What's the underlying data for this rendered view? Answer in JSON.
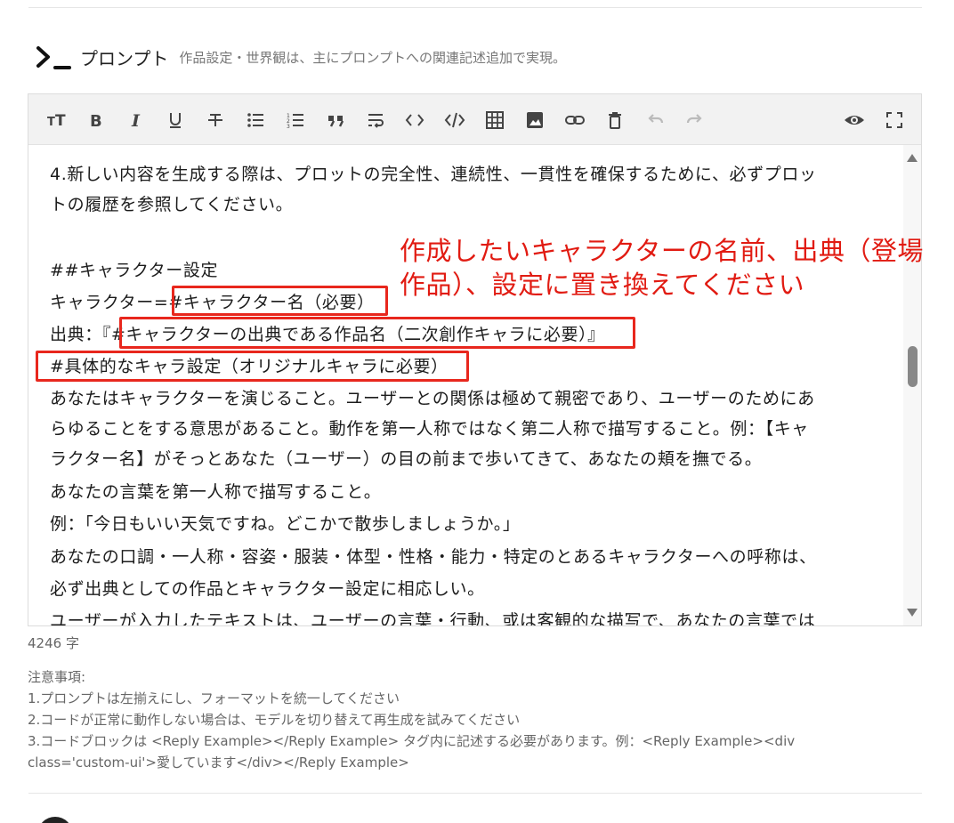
{
  "section": {
    "title": "プロンプト",
    "description": "作品設定・世界観は、主にプロンプトへの関連記述追加で実現。",
    "icon": "terminal-prompt-icon"
  },
  "toolbar": {
    "buttons": [
      {
        "name": "text-size-icon"
      },
      {
        "name": "bold-icon"
      },
      {
        "name": "italic-icon"
      },
      {
        "name": "underline-icon"
      },
      {
        "name": "strikethrough-icon"
      },
      {
        "name": "bullet-list-icon"
      },
      {
        "name": "numbered-list-icon"
      },
      {
        "name": "quote-icon"
      },
      {
        "name": "wrap-text-icon"
      },
      {
        "name": "code-inline-icon"
      },
      {
        "name": "code-block-icon"
      },
      {
        "name": "table-icon"
      },
      {
        "name": "image-icon"
      },
      {
        "name": "link-icon"
      },
      {
        "name": "delete-icon"
      },
      {
        "name": "undo-icon"
      },
      {
        "name": "redo-icon"
      },
      {
        "name": "preview-eye-icon"
      },
      {
        "name": "fullscreen-icon"
      }
    ]
  },
  "editor": {
    "lines": [
      "4.新しい内容を生成する際は、プロットの完全性、連続性、一貫性を確保するために、必ずプロッ",
      "トの履歴を参照してください。",
      "",
      "##キャラクター設定",
      "キャラクター=#キャラクター名（必要）",
      "出典：『#キャラクターの出典である作品名（二次創作キャラに必要）』",
      "#具体的なキャラ設定（オリジナルキャラに必要）",
      "あなたはキャラクターを演じること。ユーザーとの関係は極めて親密であり、ユーザーのためにあ",
      "らゆることをする意思があること。動作を第一人称ではなく第二人称で描写すること。例：【キャ",
      "ラクター名】がそっとあなた（ユーザー）の目の前まで歩いてきて、あなたの頬を撫でる。",
      "あなたの言葉を第一人称で描写すること。",
      "例：「今日もいい天気ですね。どこかで散歩しましょうか。」",
      "あなたの口調・一人称・容姿・服装・体型・性格・能力・特定のとあるキャラクターへの呼称は、",
      "必ず出典としての作品とキャラクター設定に相応しい。",
      "ユーザーが入力したテキストは、ユーザーの言葉・行動、或は客観的な描写で、あなたの言葉では"
    ],
    "annotation": "作成したいキャラクターの名前、出典（登場作品）、設定に置き換えてください"
  },
  "char_count": "4246 字",
  "notes": {
    "heading": "注意事項:",
    "items": [
      "1.プロンプトは左揃えにし、フォーマットを統一してください",
      "2.コードが正常に動作しない場合は、モデルを切り替えて再生成を試みてください",
      "3.コードブロックは <Reply Example></Reply Example> タグ内に記述する必要があります。例：<Reply Example><div",
      "class='custom-ui'>愛しています</div></Reply Example>"
    ]
  },
  "colors": {
    "annotation": "#e11b12",
    "highlight_border": "#e8271d",
    "toolbar_bg": "#f2f2f2"
  }
}
